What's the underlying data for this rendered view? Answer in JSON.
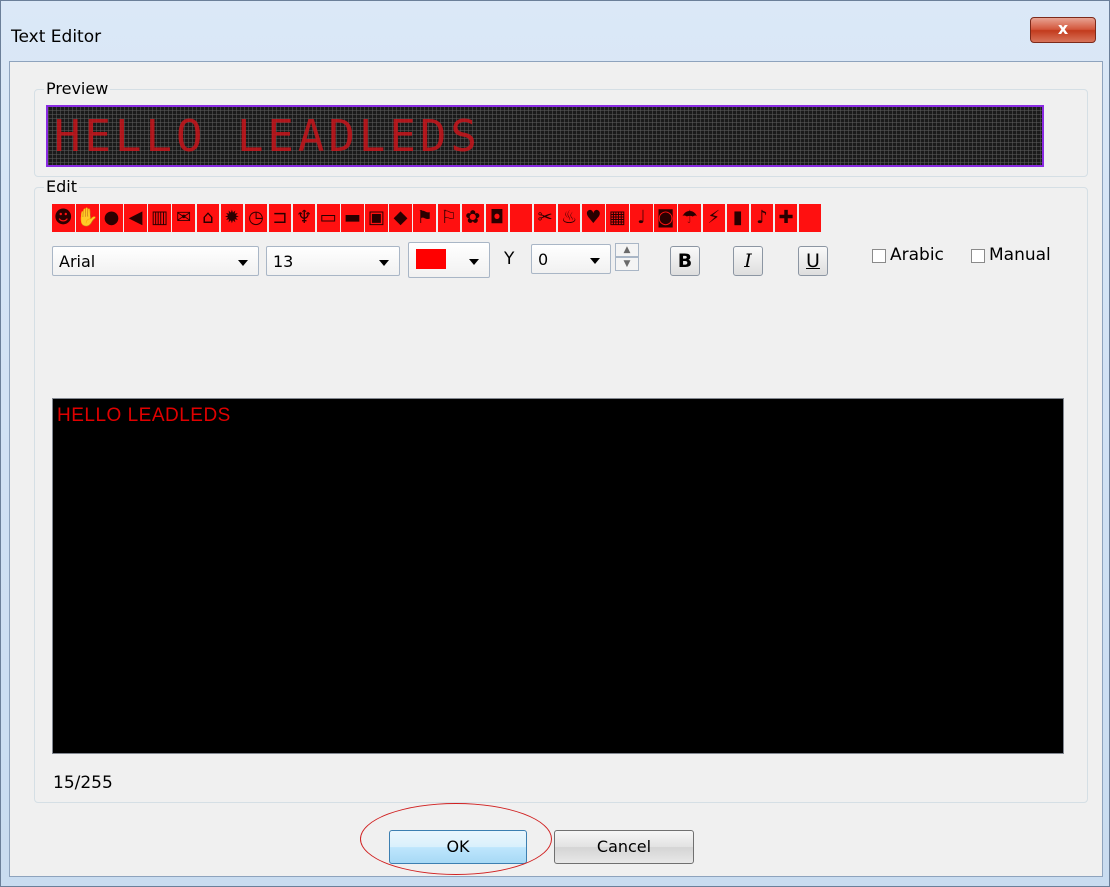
{
  "window": {
    "title": "Text Editor",
    "close_label": "x"
  },
  "preview": {
    "label": "Preview",
    "display_text": "HELLO LEADLEDS"
  },
  "edit": {
    "label": "Edit",
    "icons": [
      "smiley",
      "hand",
      "apple",
      "speaker",
      "trash",
      "mail",
      "house",
      "sun",
      "clock",
      "chair",
      "trophy",
      "monitor",
      "bed",
      "bag",
      "apple2",
      "runner",
      "runner2",
      "flower",
      "gift",
      "blank",
      "scissors",
      "bottle",
      "heart",
      "cake",
      "note",
      "coffee",
      "umbrella",
      "lightning",
      "signal",
      "music",
      "plus",
      "bar"
    ],
    "font": {
      "value": "Arial"
    },
    "size": {
      "value": "13"
    },
    "color": {
      "value": "#ff0000"
    },
    "y_label": "Y",
    "y_value": {
      "value": "0"
    },
    "bold_label": "B",
    "italic_label": "I",
    "underline_label": "U",
    "arabic_label": "Arabic",
    "manual_label": "Manual",
    "text_content": "HELLO  LEADLEDS",
    "counter": "15/255"
  },
  "buttons": {
    "ok": "OK",
    "cancel": "Cancel"
  }
}
